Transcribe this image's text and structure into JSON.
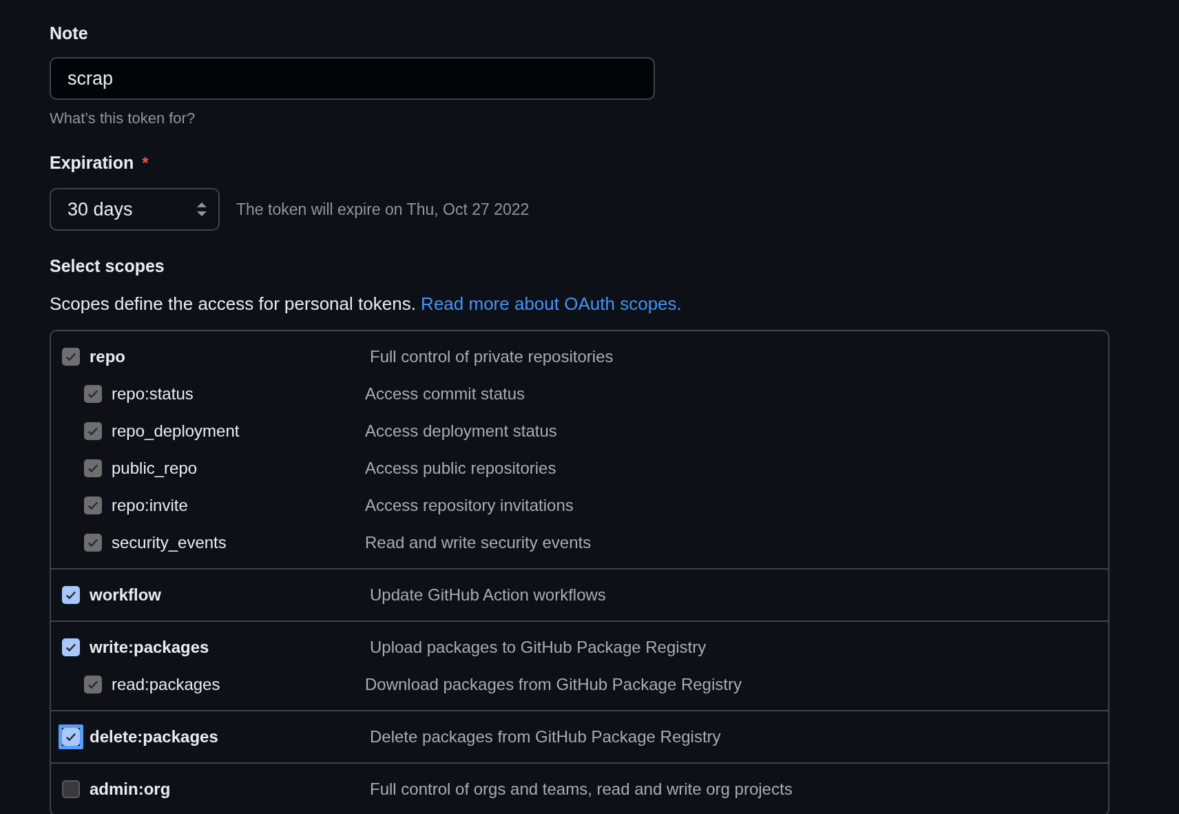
{
  "note": {
    "label": "Note",
    "value": "scrap",
    "hint": "What’s this token for?"
  },
  "expiration": {
    "label": "Expiration",
    "required_mark": "*",
    "value": "30 days",
    "info": "The token will expire on Thu, Oct 27 2022"
  },
  "scopes": {
    "title": "Select scopes",
    "description": "Scopes define the access for personal tokens.",
    "link": "Read more about OAuth scopes.",
    "groups": [
      {
        "name": "repo",
        "description": "Full control of private repositories",
        "checked": true,
        "disabled": true,
        "focused": false,
        "children": [
          {
            "name": "repo:status",
            "description": "Access commit status",
            "checked": true,
            "disabled": true
          },
          {
            "name": "repo_deployment",
            "description": "Access deployment status",
            "checked": true,
            "disabled": true
          },
          {
            "name": "public_repo",
            "description": "Access public repositories",
            "checked": true,
            "disabled": true
          },
          {
            "name": "repo:invite",
            "description": "Access repository invitations",
            "checked": true,
            "disabled": true
          },
          {
            "name": "security_events",
            "description": "Read and write security events",
            "checked": true,
            "disabled": true
          }
        ]
      },
      {
        "name": "workflow",
        "description": "Update GitHub Action workflows",
        "checked": true,
        "disabled": false,
        "focused": false
      },
      {
        "name": "write:packages",
        "description": "Upload packages to GitHub Package Registry",
        "checked": true,
        "disabled": false,
        "focused": false,
        "children": [
          {
            "name": "read:packages",
            "description": "Download packages from GitHub Package Registry",
            "checked": true,
            "disabled": true
          }
        ]
      },
      {
        "name": "delete:packages",
        "description": "Delete packages from GitHub Package Registry",
        "checked": true,
        "disabled": false,
        "focused": true
      },
      {
        "name": "admin:org",
        "description": "Full control of orgs and teams, read and write org projects",
        "checked": false,
        "disabled": false,
        "focused": false
      }
    ]
  }
}
